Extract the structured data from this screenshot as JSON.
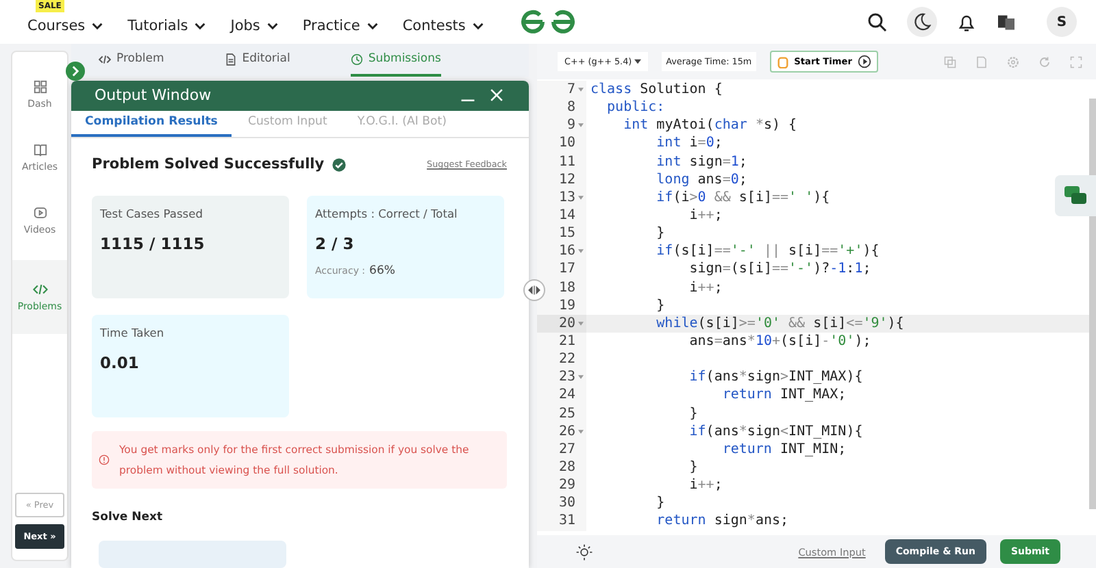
{
  "nav": {
    "badge": "SALE",
    "items": [
      {
        "label": "Courses"
      },
      {
        "label": "Tutorials"
      },
      {
        "label": "Jobs"
      },
      {
        "label": "Practice"
      },
      {
        "label": "Contests"
      }
    ],
    "avatar": "S"
  },
  "sidebar": {
    "items": [
      {
        "label": "Dash",
        "kind": "dash",
        "selected": false
      },
      {
        "label": "Articles",
        "kind": "book",
        "selected": false
      },
      {
        "label": "Videos",
        "kind": "video",
        "selected": false
      },
      {
        "label": "Problems",
        "kind": "code",
        "selected": true
      }
    ],
    "prev": "« Prev",
    "next": "Next »"
  },
  "problem_tabs": [
    {
      "label": "Problem",
      "kind": "code",
      "selected": false
    },
    {
      "label": "Editorial",
      "kind": "doc",
      "selected": false
    },
    {
      "label": "Submissions",
      "kind": "clock",
      "selected": true
    }
  ],
  "output_window": {
    "title": "Output Window",
    "tabs": [
      {
        "label": "Compilation Results",
        "selected": true
      },
      {
        "label": "Custom Input",
        "selected": false
      },
      {
        "label": "Y.O.G.I. (AI Bot)",
        "selected": false
      }
    ],
    "status": "Problem Solved Successfully",
    "feedback": "Suggest Feedback",
    "cards": [
      {
        "label": "Test Cases Passed",
        "value": "1115 / 1115",
        "kind": "grey"
      },
      {
        "label": "Attempts : Correct / Total",
        "value": "2 / 3",
        "kind": "blue",
        "note_label": "Accuracy :",
        "note_value": "66%"
      },
      {
        "label": "Time Taken",
        "value": "0.01",
        "kind": "blue"
      }
    ],
    "warning": "You get marks only for the first correct submission if you solve the problem without viewing the full solution.",
    "solve_next": "Solve Next"
  },
  "editor": {
    "language": "C++ (g++ 5.4)",
    "average_time": "Average Time: 15m",
    "timer": "Start Timer",
    "lines": [
      {
        "n": "7",
        "fold": true,
        "active": false,
        "tokens": [
          {
            "kind": "kw",
            "text": "class"
          },
          {
            "kind": "p",
            "text": " Solution {"
          }
        ]
      },
      {
        "n": "8",
        "fold": false,
        "active": false,
        "tokens": [
          {
            "kind": "kw",
            "text": "  public:"
          }
        ]
      },
      {
        "n": "9",
        "fold": true,
        "active": false,
        "tokens": [
          {
            "kind": "kw",
            "text": "    int"
          },
          {
            "kind": "p",
            "text": " myAtoi("
          },
          {
            "kind": "kw",
            "text": "char"
          },
          {
            "kind": "op",
            "text": " *"
          },
          {
            "kind": "p",
            "text": "s) {"
          }
        ]
      },
      {
        "n": "10",
        "fold": false,
        "active": false,
        "tokens": [
          {
            "kind": "kw",
            "text": "        int"
          },
          {
            "kind": "p",
            "text": " i"
          },
          {
            "kind": "op",
            "text": "="
          },
          {
            "kind": "num",
            "text": "0"
          },
          {
            "kind": "p",
            "text": ";"
          }
        ]
      },
      {
        "n": "11",
        "fold": false,
        "active": false,
        "tokens": [
          {
            "kind": "kw",
            "text": "        int"
          },
          {
            "kind": "p",
            "text": " sign"
          },
          {
            "kind": "op",
            "text": "="
          },
          {
            "kind": "num",
            "text": "1"
          },
          {
            "kind": "p",
            "text": ";"
          }
        ]
      },
      {
        "n": "12",
        "fold": false,
        "active": false,
        "tokens": [
          {
            "kind": "kw",
            "text": "        long"
          },
          {
            "kind": "p",
            "text": " ans"
          },
          {
            "kind": "op",
            "text": "="
          },
          {
            "kind": "num",
            "text": "0"
          },
          {
            "kind": "p",
            "text": ";"
          }
        ]
      },
      {
        "n": "13",
        "fold": true,
        "active": false,
        "tokens": [
          {
            "kind": "kw",
            "text": "        if"
          },
          {
            "kind": "p",
            "text": "(i"
          },
          {
            "kind": "op",
            "text": ">"
          },
          {
            "kind": "num",
            "text": "0"
          },
          {
            "kind": "op",
            "text": " &&"
          },
          {
            "kind": "p",
            "text": " s[i]"
          },
          {
            "kind": "op",
            "text": "=="
          },
          {
            "kind": "str",
            "text": "' '"
          },
          {
            "kind": "p",
            "text": "){"
          }
        ]
      },
      {
        "n": "14",
        "fold": false,
        "active": false,
        "tokens": [
          {
            "kind": "p",
            "text": "            i"
          },
          {
            "kind": "op",
            "text": "++"
          },
          {
            "kind": "p",
            "text": ";"
          }
        ]
      },
      {
        "n": "15",
        "fold": false,
        "active": false,
        "tokens": [
          {
            "kind": "p",
            "text": "        }"
          }
        ]
      },
      {
        "n": "16",
        "fold": true,
        "active": false,
        "tokens": [
          {
            "kind": "kw",
            "text": "        if"
          },
          {
            "kind": "p",
            "text": "(s[i]"
          },
          {
            "kind": "op",
            "text": "=="
          },
          {
            "kind": "str",
            "text": "'-'"
          },
          {
            "kind": "op",
            "text": " ||"
          },
          {
            "kind": "p",
            "text": " s[i]"
          },
          {
            "kind": "op",
            "text": "=="
          },
          {
            "kind": "str",
            "text": "'+'"
          },
          {
            "kind": "p",
            "text": "){"
          }
        ]
      },
      {
        "n": "17",
        "fold": false,
        "active": false,
        "tokens": [
          {
            "kind": "p",
            "text": "            sign"
          },
          {
            "kind": "op",
            "text": "="
          },
          {
            "kind": "p",
            "text": "(s[i]"
          },
          {
            "kind": "op",
            "text": "=="
          },
          {
            "kind": "str",
            "text": "'-'"
          },
          {
            "kind": "p",
            "text": ")?"
          },
          {
            "kind": "num",
            "text": "-1"
          },
          {
            "kind": "p",
            "text": ":"
          },
          {
            "kind": "num",
            "text": "1"
          },
          {
            "kind": "p",
            "text": ";"
          }
        ]
      },
      {
        "n": "18",
        "fold": false,
        "active": false,
        "tokens": [
          {
            "kind": "p",
            "text": "            i"
          },
          {
            "kind": "op",
            "text": "++"
          },
          {
            "kind": "p",
            "text": ";"
          }
        ]
      },
      {
        "n": "19",
        "fold": false,
        "active": false,
        "tokens": [
          {
            "kind": "p",
            "text": "        }"
          }
        ]
      },
      {
        "n": "20",
        "fold": true,
        "active": true,
        "tokens": [
          {
            "kind": "kw",
            "text": "        while"
          },
          {
            "kind": "p",
            "text": "(s[i]"
          },
          {
            "kind": "op",
            "text": ">="
          },
          {
            "kind": "str",
            "text": "'0'"
          },
          {
            "kind": "op",
            "text": " &&"
          },
          {
            "kind": "p",
            "text": " s[i]"
          },
          {
            "kind": "op",
            "text": "<="
          },
          {
            "kind": "str",
            "text": "'9'"
          },
          {
            "kind": "p",
            "text": "){"
          }
        ]
      },
      {
        "n": "21",
        "fold": false,
        "active": false,
        "tokens": [
          {
            "kind": "p",
            "text": "            ans"
          },
          {
            "kind": "op",
            "text": "="
          },
          {
            "kind": "p",
            "text": "ans"
          },
          {
            "kind": "op",
            "text": "*"
          },
          {
            "kind": "num",
            "text": "10"
          },
          {
            "kind": "op",
            "text": "+"
          },
          {
            "kind": "p",
            "text": "(s[i]"
          },
          {
            "kind": "op",
            "text": "-"
          },
          {
            "kind": "str",
            "text": "'0'"
          },
          {
            "kind": "p",
            "text": ");"
          }
        ]
      },
      {
        "n": "22",
        "fold": false,
        "active": false
      },
      {
        "n": "23",
        "fold": true,
        "active": false,
        "tokens": [
          {
            "kind": "kw",
            "text": "            if"
          },
          {
            "kind": "p",
            "text": "(ans"
          },
          {
            "kind": "op",
            "text": "*"
          },
          {
            "kind": "p",
            "text": "sign"
          },
          {
            "kind": "op",
            "text": ">"
          },
          {
            "kind": "p",
            "text": "INT_MAX){"
          }
        ]
      },
      {
        "n": "24",
        "fold": false,
        "active": false,
        "tokens": [
          {
            "kind": "kw",
            "text": "                return"
          },
          {
            "kind": "p",
            "text": " INT_MAX;"
          }
        ]
      },
      {
        "n": "25",
        "fold": false,
        "active": false,
        "tokens": [
          {
            "kind": "p",
            "text": "            }"
          }
        ]
      },
      {
        "n": "26",
        "fold": true,
        "active": false,
        "tokens": [
          {
            "kind": "kw",
            "text": "            if"
          },
          {
            "kind": "p",
            "text": "(ans"
          },
          {
            "kind": "op",
            "text": "*"
          },
          {
            "kind": "p",
            "text": "sign"
          },
          {
            "kind": "op",
            "text": "<"
          },
          {
            "kind": "p",
            "text": "INT_MIN){"
          }
        ]
      },
      {
        "n": "27",
        "fold": false,
        "active": false,
        "tokens": [
          {
            "kind": "kw",
            "text": "                return"
          },
          {
            "kind": "p",
            "text": " INT_MIN;"
          }
        ]
      },
      {
        "n": "28",
        "fold": false,
        "active": false,
        "tokens": [
          {
            "kind": "p",
            "text": "            }"
          }
        ]
      },
      {
        "n": "29",
        "fold": false,
        "active": false,
        "tokens": [
          {
            "kind": "p",
            "text": "            i"
          },
          {
            "kind": "op",
            "text": "++"
          },
          {
            "kind": "p",
            "text": ";"
          }
        ]
      },
      {
        "n": "30",
        "fold": false,
        "active": false,
        "tokens": [
          {
            "kind": "p",
            "text": "        }"
          }
        ]
      },
      {
        "n": "31",
        "fold": false,
        "active": false,
        "tokens": [
          {
            "kind": "kw",
            "text": "        return"
          },
          {
            "kind": "p",
            "text": " sign"
          },
          {
            "kind": "op",
            "text": "*"
          },
          {
            "kind": "p",
            "text": "ans;"
          }
        ]
      }
    ],
    "custom_input": "Custom Input",
    "compile": "Compile & Run",
    "submit": "Submit"
  }
}
